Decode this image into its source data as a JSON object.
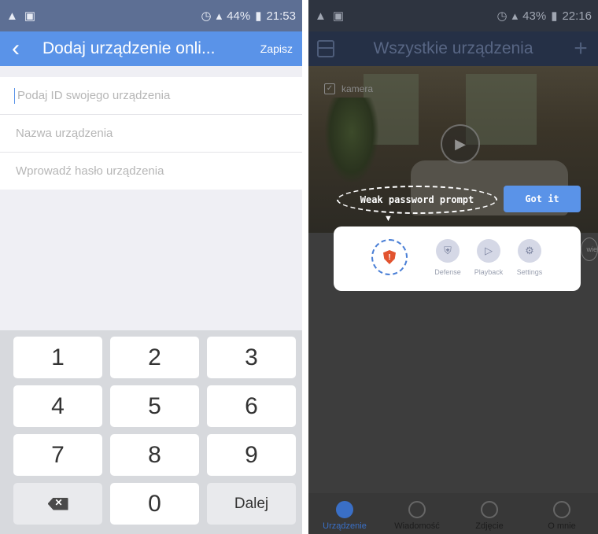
{
  "left": {
    "status": {
      "battery": "44%",
      "time": "21:53"
    },
    "nav": {
      "back": "‹",
      "title": "Dodaj urządzenie onli...",
      "save": "Zapisz"
    },
    "form": {
      "id_placeholder": "Podaj ID swojego urządzenia",
      "name_placeholder": "Nazwa urządzenia",
      "password_placeholder": "Wprowadź hasło urządzenia"
    },
    "keypad": {
      "k1": "1",
      "k2": "2",
      "k3": "3",
      "k4": "4",
      "k5": "5",
      "k6": "6",
      "k7": "7",
      "k8": "8",
      "k9": "9",
      "k0": "0",
      "next": "Dalej"
    }
  },
  "right": {
    "status": {
      "battery": "43%",
      "time": "22:16"
    },
    "nav": {
      "title": "Wszystkie urządzenia",
      "add": "+"
    },
    "camera": {
      "name": "kamera"
    },
    "tooltip": {
      "text": "Weak password prompt",
      "button": "Got it"
    },
    "actions": {
      "defense": "Defense",
      "playback": "Playback",
      "settings": "Settings"
    },
    "side_label": "wie",
    "tabs": {
      "devices": "Urządzenie",
      "messages": "Wiadomość",
      "photos": "Zdjęcie",
      "about": "O mnie"
    }
  }
}
